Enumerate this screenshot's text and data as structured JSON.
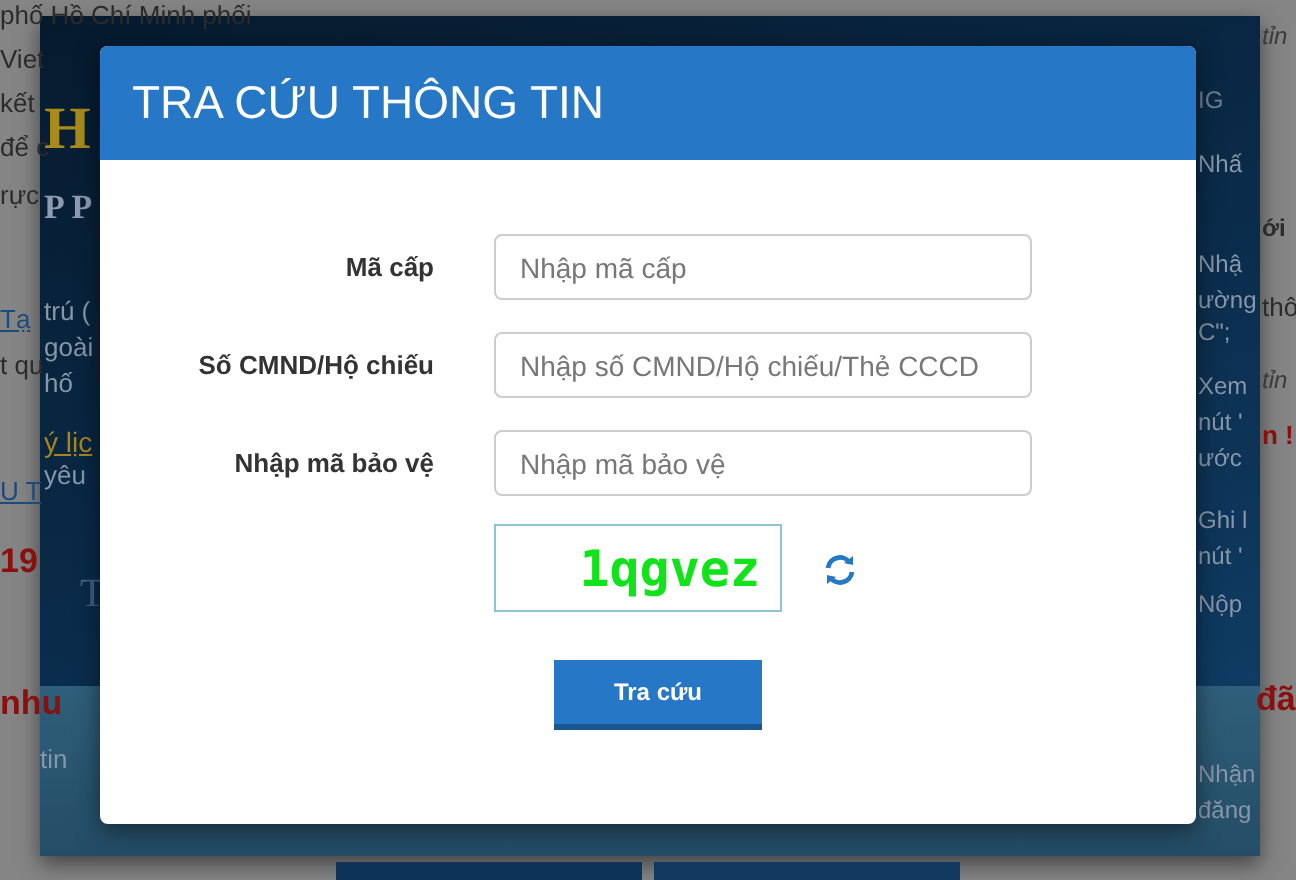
{
  "background": {
    "left_gray": [
      {
        "text": "phố Hồ Chí Minh phối",
        "kind": "plain"
      },
      {
        "text": "Viet",
        "kind": "plain"
      },
      {
        "text": "kết",
        "kind": "plain"
      },
      {
        "text": "để c",
        "kind": "plain"
      },
      {
        "text": "rực",
        "kind": "plain"
      },
      {
        "text": "Tạ",
        "kind": "link"
      },
      {
        "text": "t qu",
        "kind": "plain"
      },
      {
        "text": "U T",
        "kind": "link"
      },
      {
        "text": "19",
        "kind": "red"
      },
      {
        "text": "nhu",
        "kind": "red"
      }
    ],
    "banner_left": [
      {
        "text": "H",
        "kind": "gold"
      },
      {
        "text": "P P",
        "kind": "serif"
      },
      {
        "text": "trú (",
        "kind": "plain"
      },
      {
        "text": "goài",
        "kind": "plain"
      },
      {
        "text": "hố",
        "kind": "plain"
      },
      {
        "text": "ý lịc",
        "kind": "goldlink"
      },
      {
        "text": "yêu",
        "kind": "plain"
      },
      {
        "text": "T",
        "kind": "serifblue"
      },
      {
        "text": "tin",
        "kind": "plain"
      }
    ],
    "banner_right": [
      {
        "text": "IG",
        "kind": "big"
      },
      {
        "text": "Nhấ",
        "kind": "plain"
      },
      {
        "text": "Nhậ",
        "kind": "plain"
      },
      {
        "text": "ường",
        "kind": "plain"
      },
      {
        "text": "C\";",
        "kind": "plain"
      },
      {
        "text": "Xem",
        "kind": "plain"
      },
      {
        "text": "nút '",
        "kind": "plain"
      },
      {
        "text": "ước",
        "kind": "plain"
      },
      {
        "text": "Ghi l",
        "kind": "plain"
      },
      {
        "text": "nút '",
        "kind": "plain"
      },
      {
        "text": "Nộp",
        "kind": "plain"
      },
      {
        "text": "Nhận",
        "kind": "plain"
      },
      {
        "text": "đăng",
        "kind": "plain"
      }
    ],
    "right_gray": [
      {
        "text": "tỉn",
        "kind": "italic"
      },
      {
        "text": "ới",
        "kind": "bold"
      },
      {
        "text": "thô",
        "kind": "plain"
      },
      {
        "text": "tỉn",
        "kind": "italic"
      },
      {
        "text": "n !",
        "kind": "red"
      },
      {
        "text": "đã",
        "kind": "red"
      }
    ],
    "nav_buttons": [
      {
        "kind": "back"
      },
      {
        "kind": "next"
      }
    ]
  },
  "dialog": {
    "title": "TRA CỨU THÔNG TIN",
    "fields": [
      {
        "label": "Mã cấp",
        "placeholder": "Nhập mã cấp"
      },
      {
        "label": "Số CMND/Hộ chiếu",
        "placeholder": "Nhập số CMND/Hộ chiếu/Thẻ CCCD"
      },
      {
        "label": "Nhập mã bảo vệ",
        "placeholder": "Nhập mã bảo vệ"
      }
    ],
    "captcha": "1qgvez",
    "submit": "Tra cứu"
  }
}
